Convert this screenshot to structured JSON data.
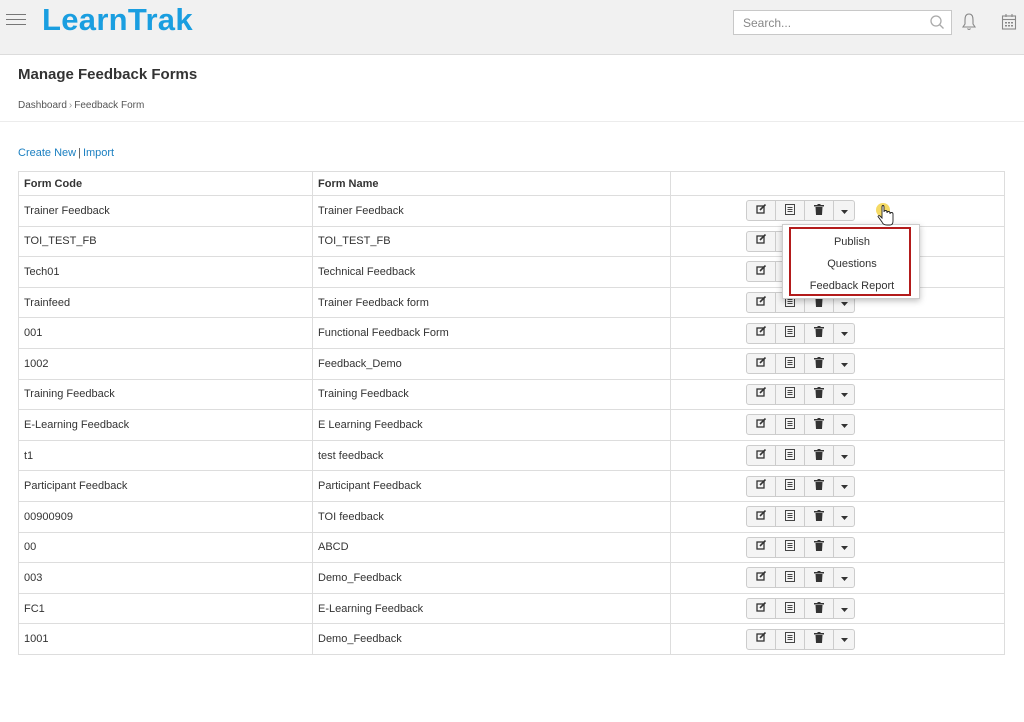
{
  "header": {
    "logo": "LearnTrak",
    "search_placeholder": "Search..."
  },
  "page": {
    "title": "Manage Feedback Forms",
    "breadcrumb": {
      "home": "Dashboard",
      "current": "Feedback Form"
    },
    "links": {
      "create": "Create New",
      "import": "Import"
    }
  },
  "table": {
    "columns": [
      "Form Code",
      "Form Name"
    ],
    "rows": [
      {
        "code": "Trainer Feedback",
        "name": "Trainer Feedback"
      },
      {
        "code": "TOI_TEST_FB",
        "name": "TOI_TEST_FB"
      },
      {
        "code": "Tech01",
        "name": "Technical Feedback"
      },
      {
        "code": "Trainfeed",
        "name": "Trainer Feedback form"
      },
      {
        "code": "001",
        "name": "Functional Feedback Form"
      },
      {
        "code": "1002",
        "name": "Feedback_Demo"
      },
      {
        "code": "Training Feedback",
        "name": "Training Feedback"
      },
      {
        "code": "E-Learning Feedback",
        "name": "E Learning Feedback"
      },
      {
        "code": "t1",
        "name": "test feedback"
      },
      {
        "code": "Participant Feedback",
        "name": "Participant Feedback"
      },
      {
        "code": "00900909",
        "name": "TOI feedback"
      },
      {
        "code": "00",
        "name": "ABCD"
      },
      {
        "code": "003",
        "name": "Demo_Feedback"
      },
      {
        "code": "FC1",
        "name": "E-Learning Feedback"
      },
      {
        "code": "1001",
        "name": "Demo_Feedback"
      }
    ]
  },
  "dropdown": {
    "items": [
      "Publish",
      "Questions",
      "Feedback Report"
    ]
  },
  "colors": {
    "brand": "#1a9ee0",
    "link": "#1a7fc1",
    "highlight": "#b31b1b"
  }
}
